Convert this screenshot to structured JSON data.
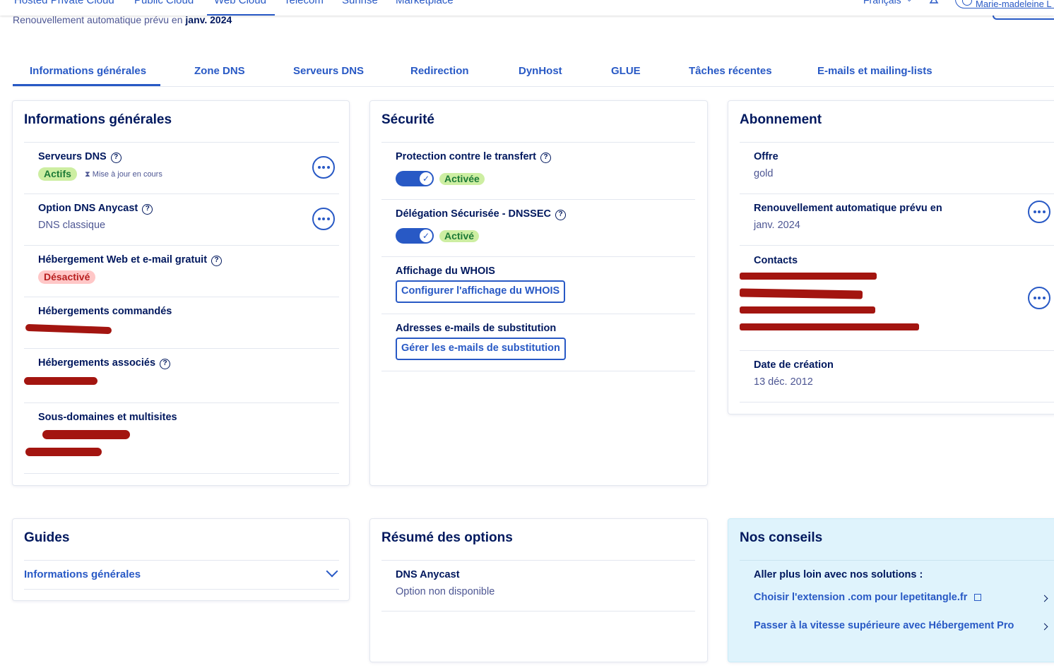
{
  "topnav": {
    "items": [
      "Hosted Private Cloud",
      "Public Cloud",
      "Web Cloud",
      "Telecom",
      "Sunrise",
      "Marketplace"
    ],
    "language": "Français",
    "user": "Marie-madeleine L"
  },
  "header": {
    "renewal_prefix": "Renouvellement automatique prévu en",
    "renewal_date": "janv. 2024"
  },
  "tabs": [
    "Informations générales",
    "Zone DNS",
    "Serveurs DNS",
    "Redirection",
    "DynHost",
    "GLUE",
    "Tâches récentes",
    "E-mails et mailing-lists"
  ],
  "general": {
    "title": "Informations générales",
    "dns_servers_label": "Serveurs DNS",
    "dns_servers_status": "Actifs",
    "dns_servers_update": "Mise à jour en cours",
    "anycast_label": "Option DNS Anycast",
    "anycast_value": "DNS classique",
    "hosting_free_label": "Hébergement Web et e-mail gratuit",
    "hosting_free_status": "Désactivé",
    "hostings_ordered_label": "Hébergements commandés",
    "hostings_associated_label": "Hébergements associés",
    "subdomains_label": "Sous-domaines et multisites"
  },
  "security": {
    "title": "Sécurité",
    "transfer_label": "Protection contre le transfert",
    "transfer_status": "Activée",
    "dnssec_label": "Délégation Sécurisée - DNSSEC",
    "dnssec_status": "Activé",
    "whois_label": "Affichage du WHOIS",
    "whois_button": "Configurer l'affichage du WHOIS",
    "emails_label": "Adresses e-mails de substitution",
    "emails_button": "Gérer les e-mails de substitution"
  },
  "subscription": {
    "title": "Abonnement",
    "offer_label": "Offre",
    "offer_value": "gold",
    "renewal_label": "Renouvellement automatique prévu en",
    "renewal_value": "janv. 2024",
    "contacts_label": "Contacts",
    "created_label": "Date de création",
    "created_value": "13 déc. 2012"
  },
  "guides": {
    "title": "Guides",
    "link": "Informations générales"
  },
  "options": {
    "title": "Résumé des options",
    "anycast_label": "DNS Anycast",
    "anycast_value": "Option non disponible"
  },
  "tips": {
    "title": "Nos conseils",
    "subtitle": "Aller plus loin avec nos solutions :",
    "link1": "Choisir l'extension .com pour lepetitangle.fr",
    "link2": "Passer à la vitesse supérieure avec Hébergement Pro"
  },
  "colors": {
    "primary": "#2859c5",
    "text_dark": "#00185e",
    "text_muted": "#4d5693",
    "badge_green_bg": "#cdeea2",
    "badge_red_bg": "#ffc7c7",
    "tips_bg": "#dff3fc",
    "redaction": "#a31510"
  }
}
